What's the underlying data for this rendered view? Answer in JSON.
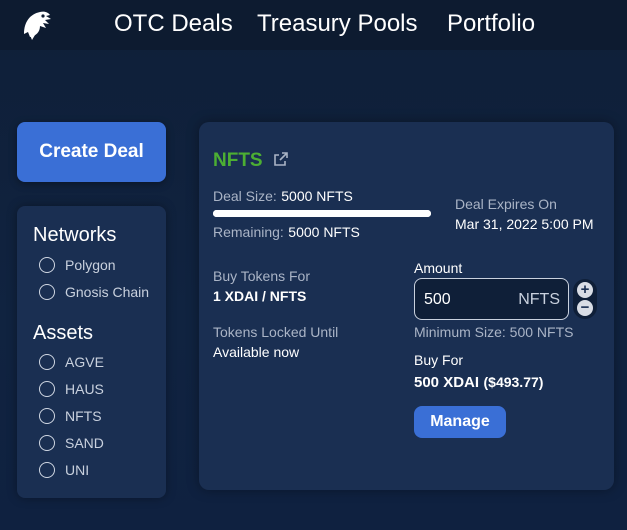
{
  "nav": {
    "items": [
      {
        "label": "OTC Deals"
      },
      {
        "label": "Treasury Pools"
      },
      {
        "label": "Portfolio"
      }
    ]
  },
  "sidebar": {
    "create_label": "Create Deal",
    "networks_title": "Networks",
    "networks": [
      {
        "label": "Polygon",
        "checked": false
      },
      {
        "label": "Gnosis Chain",
        "checked": false
      }
    ],
    "assets_title": "Assets",
    "assets": [
      {
        "label": "AGVE",
        "checked": false
      },
      {
        "label": "HAUS",
        "checked": false
      },
      {
        "label": "NFTS",
        "checked": false
      },
      {
        "label": "SAND",
        "checked": false
      },
      {
        "label": "UNI",
        "checked": false
      }
    ]
  },
  "deal": {
    "token": "NFTS",
    "deal_size_label": "Deal Size:",
    "deal_size_value": "5000 NFTS",
    "remaining_label": "Remaining:",
    "remaining_value": "5000 NFTS",
    "remaining_fraction": 1.0,
    "expires_label": "Deal Expires On",
    "expires_value": "Mar 31, 2022 5:00 PM",
    "buy_tokens_label": "Buy Tokens For",
    "buy_tokens_value": "1 XDAI / NFTS",
    "locked_label": "Tokens Locked Until",
    "locked_value": "Available now",
    "amount_label": "Amount",
    "amount_value": "500",
    "amount_unit": "NFTS",
    "plus": "+",
    "minus": "−",
    "min_size": "Minimum Size: 500 NFTS",
    "buy_for_label": "Buy For",
    "buy_for_value": "500 XDAI",
    "buy_for_usd": "($493.77)",
    "manage_label": "Manage"
  },
  "colors": {
    "accent": "#3a6fd6",
    "token_green": "#4caf33",
    "background": "#0f1f38",
    "card": "#1a2f52"
  },
  "icons": {
    "logo": "eagle-logo-icon",
    "external": "external-link-icon"
  }
}
